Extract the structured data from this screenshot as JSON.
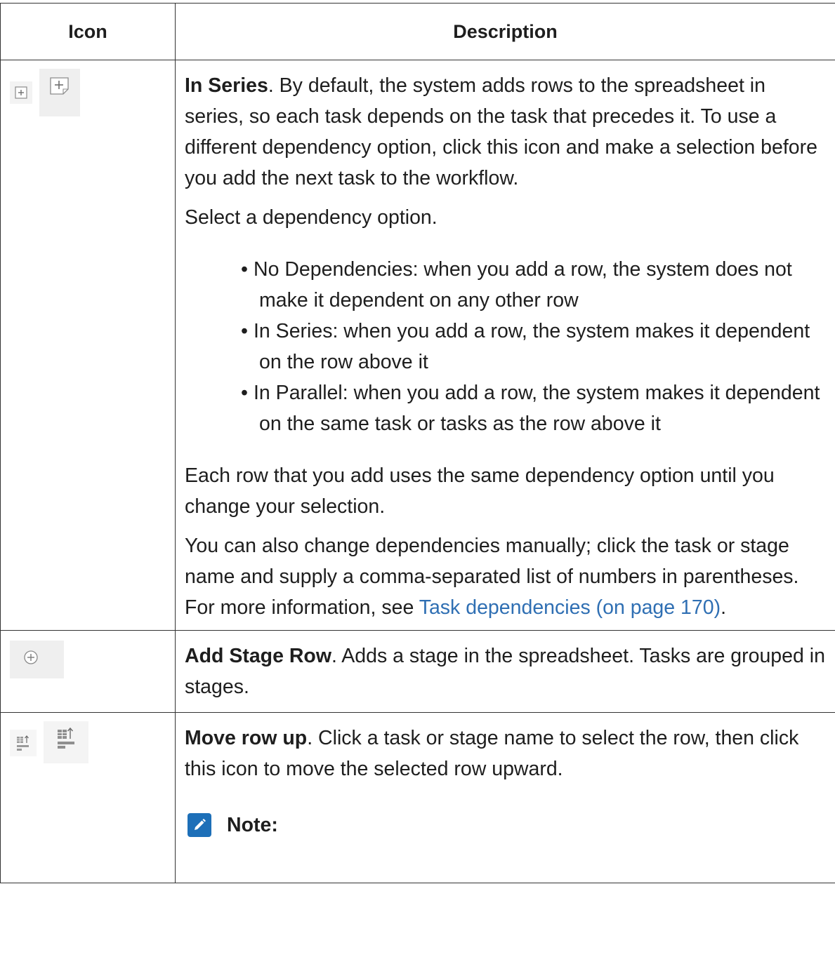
{
  "table": {
    "headers": {
      "icon": "Icon",
      "description": "Description"
    },
    "row1": {
      "title": "In Series",
      "intro": ". By default, the system adds rows to the spreadsheet in series, so each task depends on the task that precedes it. To use a different dependency option, click this icon and make a selection before you add the next task to the workflow.",
      "select_text": "Select a dependency option.",
      "options": [
        "No Dependencies: when you add a row, the system does not make it dependent on any other row",
        "In Series: when you add a row, the system makes it dependent on the row above it",
        "In Parallel: when you add a row, the system makes it depen­dent on the same task or tasks as the row above it"
      ],
      "each_row_text": "Each row that you add uses the same dependency option until you change your selection.",
      "manual_text": "You can also change dependencies manually; click the task or stage name and supply a comma-separated list of numbers in parenthe­ses. For more information, see ",
      "link_text": "Task dependencies (on page 170)",
      "link_suffix": ".",
      "icons": [
        "add-in-series-small-icon",
        "add-in-series-large-icon"
      ]
    },
    "row2": {
      "title": "Add Stage Row",
      "text": ". Adds a stage in the spreadsheet. Tasks are grouped in stages.",
      "icons": [
        "add-stage-icon"
      ]
    },
    "row3": {
      "title": "Move row up",
      "text": ". Click a task or stage name to select the row, then click this icon to move the selected row upward.",
      "note_label": "Note:",
      "icons": [
        "move-row-up-small-icon",
        "move-row-up-large-icon",
        "note-pencil-icon"
      ]
    }
  }
}
